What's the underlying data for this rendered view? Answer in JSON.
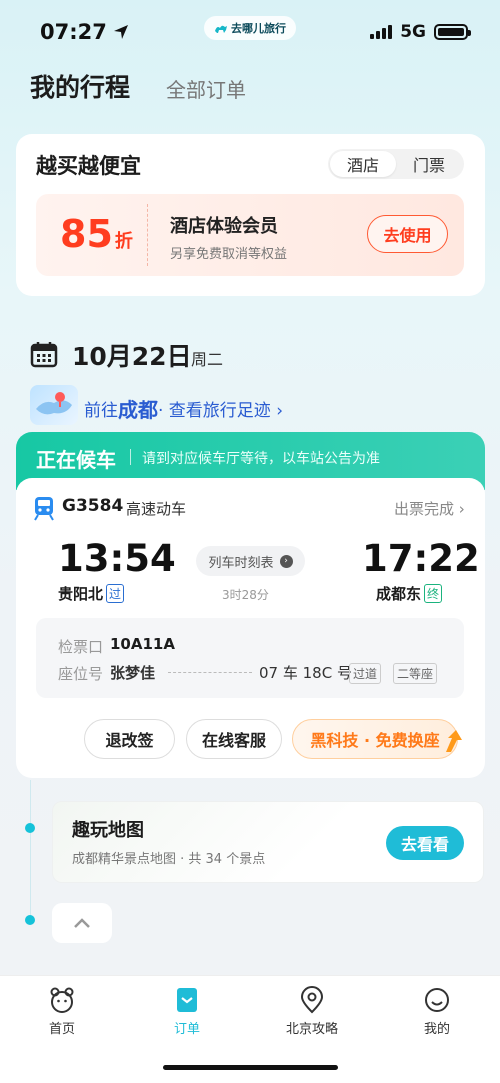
{
  "status_bar": {
    "time": "07:27",
    "app_badge": "去哪儿旅行",
    "network": "5G"
  },
  "header": {
    "title": "我的行程",
    "tab_all": "全部订单"
  },
  "promo": {
    "title": "越买越便宜",
    "tabs": [
      "酒店",
      "门票"
    ],
    "discount_value": "85",
    "discount_unit": "折",
    "name": "酒店体验会员",
    "subtitle": "另享免费取消等权益",
    "button": "去使用"
  },
  "trip": {
    "date": "10月22日",
    "weekday": "周二",
    "go_prefix": "前往",
    "city": "成都",
    "footprint": " · 查看旅行足迹 ›"
  },
  "train": {
    "status_label": "正在候车",
    "status_note": "请到对应候车厅等待，以车站公告为准",
    "number": "G3584",
    "type": "高速动车",
    "ticket_status": "出票完成 ›",
    "dep_time": "13:54",
    "arr_time": "17:22",
    "timetable": "列车时刻表",
    "duration": "3时28分",
    "dep_station": "贵阳北",
    "dep_tag": "过",
    "arr_station": "成都东",
    "arr_tag": "终",
    "gate_label": "检票口",
    "gate_value": "10A11A",
    "seat_label": "座位号",
    "passenger": "张梦佳",
    "seat_no": "07 车 18C 号",
    "seat_tags": [
      "过道",
      "二等座"
    ],
    "btn_refund": "退改签",
    "btn_service": "在线客服",
    "btn_seat": "黑科技 · 免费换座"
  },
  "map_card": {
    "title": "趣玩地图",
    "subtitle": "成都精华景点地图 · 共 34 个景点",
    "button": "去看看"
  },
  "nav": [
    {
      "label": "首页",
      "icon": "home-icon",
      "active": false
    },
    {
      "label": "订单",
      "icon": "order-icon",
      "active": true
    },
    {
      "label": "北京攻略",
      "icon": "location-icon",
      "active": false
    },
    {
      "label": "我的",
      "icon": "profile-icon",
      "active": false
    }
  ],
  "colors": {
    "accent": "#1fbcd7",
    "status_green": "#17c8a4",
    "discount_red": "#ff3d1f",
    "link_blue": "#2a5cd1"
  }
}
